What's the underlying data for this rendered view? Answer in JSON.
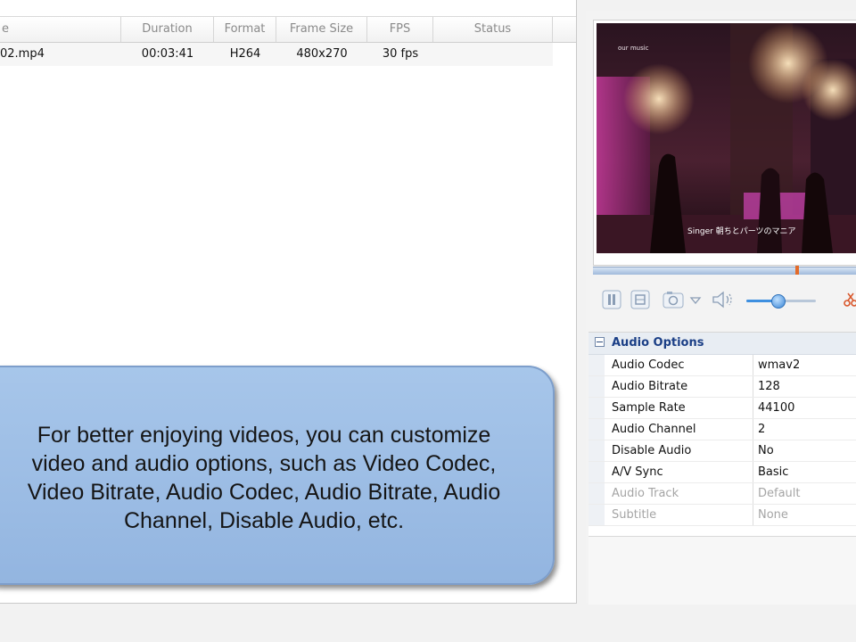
{
  "file_list": {
    "columns": [
      "e",
      "Duration",
      "Format",
      "Frame Size",
      "FPS",
      "Status"
    ],
    "rows": [
      {
        "name": "02.mp4",
        "duration": "00:03:41",
        "format": "H264",
        "frame_size": "480x270",
        "fps": "30 fps",
        "status": ""
      }
    ]
  },
  "callout": {
    "lines": [
      "For better enjoying videos, you can customize",
      "video and audio options, such as Video Codec,",
      "Video Bitrate, Audio Codec, Audio Bitrate, Audio",
      "Channel, Disable Audio, etc."
    ]
  },
  "preview": {
    "overlay_top": "our music",
    "overlay_bottom": "Singer  朝ちとパーツのマニア",
    "seek_position_fraction": 0.78,
    "volume_fraction": 0.45,
    "icons": [
      "pause-icon",
      "stop-icon",
      "snapshot-icon",
      "dropdown-arrow-icon",
      "volume-icon",
      "cut-icon"
    ]
  },
  "audio_options": {
    "title": "Audio Options",
    "rows": [
      {
        "name": "Audio Codec",
        "value": "wmav2",
        "enabled": true
      },
      {
        "name": "Audio Bitrate",
        "value": "128",
        "enabled": true
      },
      {
        "name": "Sample Rate",
        "value": "44100",
        "enabled": true
      },
      {
        "name": "Audio Channel",
        "value": "2",
        "enabled": true
      },
      {
        "name": "Disable Audio",
        "value": "No",
        "enabled": true
      },
      {
        "name": "A/V Sync",
        "value": "Basic",
        "enabled": true
      },
      {
        "name": "Audio Track",
        "value": "Default",
        "enabled": false
      },
      {
        "name": "Subtitle",
        "value": "None",
        "enabled": false
      }
    ]
  },
  "colors": {
    "accent": "#1b3f86",
    "callout_fill": "#9dbde6",
    "volume_fill": "#3d8fe0",
    "seek_marker": "#e36b2a"
  }
}
